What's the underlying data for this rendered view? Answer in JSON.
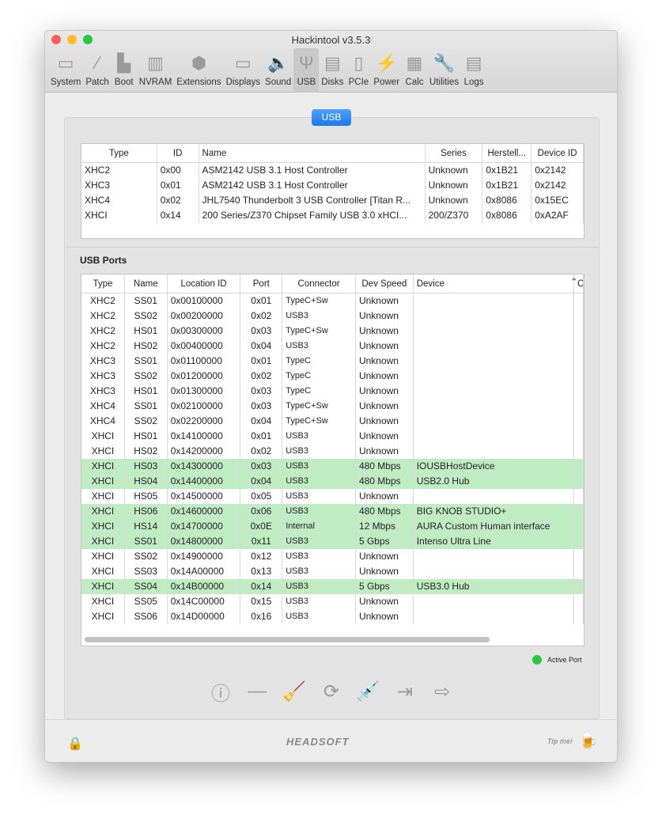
{
  "window": {
    "title": "Hackintool v3.5.3"
  },
  "toolbar": [
    {
      "label": "System",
      "icon": "system-icon",
      "glyph": "▭"
    },
    {
      "label": "Patch",
      "icon": "bandage-icon",
      "glyph": "⁄"
    },
    {
      "label": "Boot",
      "icon": "boot-icon",
      "glyph": "▙"
    },
    {
      "label": "NVRAM",
      "icon": "nvram-icon",
      "glyph": "▥"
    },
    {
      "label": "Extensions",
      "icon": "extensions-icon",
      "glyph": "⬢"
    },
    {
      "label": "Displays",
      "icon": "display-icon",
      "glyph": "▭"
    },
    {
      "label": "Sound",
      "icon": "speaker-icon",
      "glyph": "🔈"
    },
    {
      "label": "USB",
      "icon": "usb-icon",
      "glyph": "Ψ",
      "selected": true
    },
    {
      "label": "Disks",
      "icon": "disk-icon",
      "glyph": "▤"
    },
    {
      "label": "PCIe",
      "icon": "pcie-icon",
      "glyph": "▯"
    },
    {
      "label": "Power",
      "icon": "power-icon",
      "glyph": "⚡"
    },
    {
      "label": "Calc",
      "icon": "calculator-icon",
      "glyph": "▦"
    },
    {
      "label": "Utilities",
      "icon": "wrench-icon",
      "glyph": "🔧"
    },
    {
      "label": "Logs",
      "icon": "logs-icon",
      "glyph": "▤"
    }
  ],
  "segment": {
    "label": "USB"
  },
  "controllers": {
    "columns": [
      "Type",
      "ID",
      "Name",
      "Series",
      "Herstell...",
      "Device ID"
    ],
    "rows": [
      [
        "XHC2",
        "0x00",
        "ASM2142 USB 3.1 Host Controller",
        "Unknown",
        "0x1B21",
        "0x2142"
      ],
      [
        "XHC3",
        "0x01",
        "ASM2142 USB 3.1 Host Controller",
        "Unknown",
        "0x1B21",
        "0x2142"
      ],
      [
        "XHC4",
        "0x02",
        "JHL7540 Thunderbolt 3 USB Controller [Titan R...",
        "Unknown",
        "0x8086",
        "0x15EC"
      ],
      [
        "XHCI",
        "0x14",
        "200 Series/Z370 Chipset Family USB 3.0 xHCI...",
        "200/Z370",
        "0x8086",
        "0xA2AF"
      ]
    ]
  },
  "ports_title": "USB Ports",
  "ports": {
    "columns": [
      "Type",
      "Name",
      "Location ID",
      "Port",
      "Connector",
      "Dev Speed",
      "Device",
      "C"
    ],
    "rows": [
      {
        "c": [
          "XHC2",
          "SS01",
          "0x00100000",
          "0x01",
          "TypeC+Sw",
          "Unknown",
          ""
        ],
        "active": false
      },
      {
        "c": [
          "XHC2",
          "SS02",
          "0x00200000",
          "0x02",
          "USB3",
          "Unknown",
          ""
        ],
        "active": false
      },
      {
        "c": [
          "XHC2",
          "HS01",
          "0x00300000",
          "0x03",
          "TypeC+Sw",
          "Unknown",
          ""
        ],
        "active": false
      },
      {
        "c": [
          "XHC2",
          "HS02",
          "0x00400000",
          "0x04",
          "USB3",
          "Unknown",
          ""
        ],
        "active": false
      },
      {
        "c": [
          "XHC3",
          "SS01",
          "0x01100000",
          "0x01",
          "TypeC",
          "Unknown",
          ""
        ],
        "active": false
      },
      {
        "c": [
          "XHC3",
          "SS02",
          "0x01200000",
          "0x02",
          "TypeC",
          "Unknown",
          ""
        ],
        "active": false
      },
      {
        "c": [
          "XHC3",
          "HS01",
          "0x01300000",
          "0x03",
          "TypeC",
          "Unknown",
          ""
        ],
        "active": false
      },
      {
        "c": [
          "XHC4",
          "SS01",
          "0x02100000",
          "0x03",
          "TypeC+Sw",
          "Unknown",
          ""
        ],
        "active": false
      },
      {
        "c": [
          "XHC4",
          "SS02",
          "0x02200000",
          "0x04",
          "TypeC+Sw",
          "Unknown",
          ""
        ],
        "active": false
      },
      {
        "c": [
          "XHCI",
          "HS01",
          "0x14100000",
          "0x01",
          "USB3",
          "Unknown",
          ""
        ],
        "active": false
      },
      {
        "c": [
          "XHCI",
          "HS02",
          "0x14200000",
          "0x02",
          "USB3",
          "Unknown",
          ""
        ],
        "active": false
      },
      {
        "c": [
          "XHCI",
          "HS03",
          "0x14300000",
          "0x03",
          "USB3",
          "480 Mbps",
          "IOUSBHostDevice"
        ],
        "active": true
      },
      {
        "c": [
          "XHCI",
          "HS04",
          "0x14400000",
          "0x04",
          "USB3",
          "480 Mbps",
          "USB2.0 Hub"
        ],
        "active": true
      },
      {
        "c": [
          "XHCI",
          "HS05",
          "0x14500000",
          "0x05",
          "USB3",
          "Unknown",
          ""
        ],
        "active": false
      },
      {
        "c": [
          "XHCI",
          "HS06",
          "0x14600000",
          "0x06",
          "USB3",
          "480 Mbps",
          "BIG KNOB STUDIO+"
        ],
        "active": true
      },
      {
        "c": [
          "XHCI",
          "HS14",
          "0x14700000",
          "0x0E",
          "Internal",
          "12 Mbps",
          "AURA Custom Human interface"
        ],
        "active": true
      },
      {
        "c": [
          "XHCI",
          "SS01",
          "0x14800000",
          "0x11",
          "USB3",
          "5 Gbps",
          "Intenso Ultra Line"
        ],
        "active": true
      },
      {
        "c": [
          "XHCI",
          "SS02",
          "0x14900000",
          "0x12",
          "USB3",
          "Unknown",
          ""
        ],
        "active": false
      },
      {
        "c": [
          "XHCI",
          "SS03",
          "0x14A00000",
          "0x13",
          "USB3",
          "Unknown",
          ""
        ],
        "active": false
      },
      {
        "c": [
          "XHCI",
          "SS04",
          "0x14B00000",
          "0x14",
          "USB3",
          "5 Gbps",
          "USB3.0 Hub"
        ],
        "active": true
      },
      {
        "c": [
          "XHCI",
          "SS05",
          "0x14C00000",
          "0x15",
          "USB3",
          "Unknown",
          ""
        ],
        "active": false
      },
      {
        "c": [
          "XHCI",
          "SS06",
          "0x14D00000",
          "0x16",
          "USB3",
          "Unknown",
          ""
        ],
        "active": false
      }
    ]
  },
  "legend": {
    "label": "Active Port",
    "color": "#2ac840"
  },
  "colors": {
    "active_row": "#c0ecc4",
    "accent": "#1b76f0"
  },
  "actions": [
    {
      "icon": "info-icon",
      "glyph": "ⓘ"
    },
    {
      "icon": "minus-icon",
      "glyph": "—"
    },
    {
      "icon": "broom-icon",
      "glyph": "🧹"
    },
    {
      "icon": "refresh-icon",
      "glyph": "⟳"
    },
    {
      "icon": "syringe-icon",
      "glyph": "💉"
    },
    {
      "icon": "import-icon",
      "glyph": "⇥"
    },
    {
      "icon": "export-icon",
      "glyph": "⇨"
    }
  ],
  "footer": {
    "brand": "HEADSOFT",
    "tip": "Tip me!"
  }
}
